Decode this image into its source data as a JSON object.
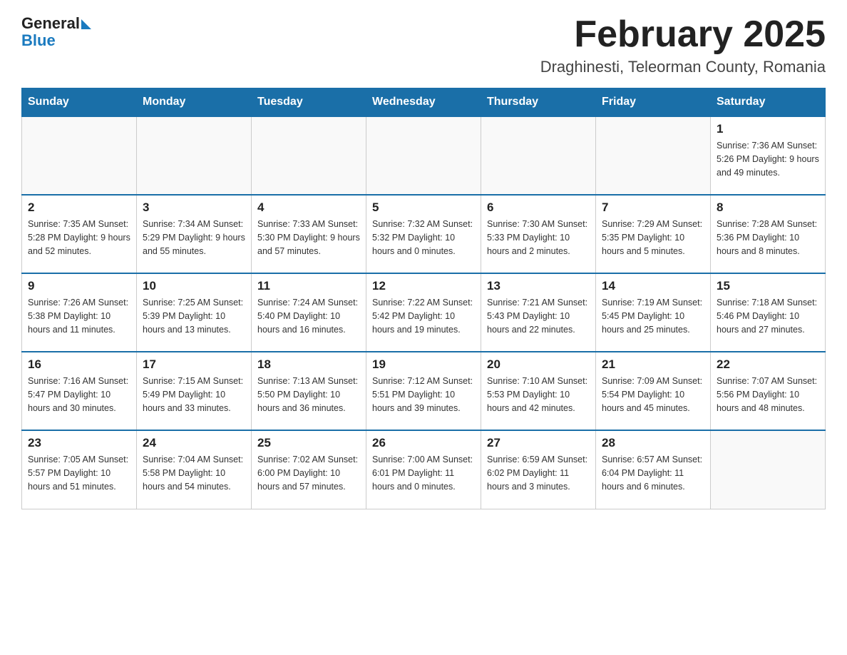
{
  "header": {
    "logo_text_general": "General",
    "logo_text_blue": "Blue",
    "title": "February 2025",
    "subtitle": "Draghinesti, Teleorman County, Romania"
  },
  "days_of_week": [
    "Sunday",
    "Monday",
    "Tuesday",
    "Wednesday",
    "Thursday",
    "Friday",
    "Saturday"
  ],
  "weeks": [
    [
      {
        "day": "",
        "info": ""
      },
      {
        "day": "",
        "info": ""
      },
      {
        "day": "",
        "info": ""
      },
      {
        "day": "",
        "info": ""
      },
      {
        "day": "",
        "info": ""
      },
      {
        "day": "",
        "info": ""
      },
      {
        "day": "1",
        "info": "Sunrise: 7:36 AM\nSunset: 5:26 PM\nDaylight: 9 hours and 49 minutes."
      }
    ],
    [
      {
        "day": "2",
        "info": "Sunrise: 7:35 AM\nSunset: 5:28 PM\nDaylight: 9 hours and 52 minutes."
      },
      {
        "day": "3",
        "info": "Sunrise: 7:34 AM\nSunset: 5:29 PM\nDaylight: 9 hours and 55 minutes."
      },
      {
        "day": "4",
        "info": "Sunrise: 7:33 AM\nSunset: 5:30 PM\nDaylight: 9 hours and 57 minutes."
      },
      {
        "day": "5",
        "info": "Sunrise: 7:32 AM\nSunset: 5:32 PM\nDaylight: 10 hours and 0 minutes."
      },
      {
        "day": "6",
        "info": "Sunrise: 7:30 AM\nSunset: 5:33 PM\nDaylight: 10 hours and 2 minutes."
      },
      {
        "day": "7",
        "info": "Sunrise: 7:29 AM\nSunset: 5:35 PM\nDaylight: 10 hours and 5 minutes."
      },
      {
        "day": "8",
        "info": "Sunrise: 7:28 AM\nSunset: 5:36 PM\nDaylight: 10 hours and 8 minutes."
      }
    ],
    [
      {
        "day": "9",
        "info": "Sunrise: 7:26 AM\nSunset: 5:38 PM\nDaylight: 10 hours and 11 minutes."
      },
      {
        "day": "10",
        "info": "Sunrise: 7:25 AM\nSunset: 5:39 PM\nDaylight: 10 hours and 13 minutes."
      },
      {
        "day": "11",
        "info": "Sunrise: 7:24 AM\nSunset: 5:40 PM\nDaylight: 10 hours and 16 minutes."
      },
      {
        "day": "12",
        "info": "Sunrise: 7:22 AM\nSunset: 5:42 PM\nDaylight: 10 hours and 19 minutes."
      },
      {
        "day": "13",
        "info": "Sunrise: 7:21 AM\nSunset: 5:43 PM\nDaylight: 10 hours and 22 minutes."
      },
      {
        "day": "14",
        "info": "Sunrise: 7:19 AM\nSunset: 5:45 PM\nDaylight: 10 hours and 25 minutes."
      },
      {
        "day": "15",
        "info": "Sunrise: 7:18 AM\nSunset: 5:46 PM\nDaylight: 10 hours and 27 minutes."
      }
    ],
    [
      {
        "day": "16",
        "info": "Sunrise: 7:16 AM\nSunset: 5:47 PM\nDaylight: 10 hours and 30 minutes."
      },
      {
        "day": "17",
        "info": "Sunrise: 7:15 AM\nSunset: 5:49 PM\nDaylight: 10 hours and 33 minutes."
      },
      {
        "day": "18",
        "info": "Sunrise: 7:13 AM\nSunset: 5:50 PM\nDaylight: 10 hours and 36 minutes."
      },
      {
        "day": "19",
        "info": "Sunrise: 7:12 AM\nSunset: 5:51 PM\nDaylight: 10 hours and 39 minutes."
      },
      {
        "day": "20",
        "info": "Sunrise: 7:10 AM\nSunset: 5:53 PM\nDaylight: 10 hours and 42 minutes."
      },
      {
        "day": "21",
        "info": "Sunrise: 7:09 AM\nSunset: 5:54 PM\nDaylight: 10 hours and 45 minutes."
      },
      {
        "day": "22",
        "info": "Sunrise: 7:07 AM\nSunset: 5:56 PM\nDaylight: 10 hours and 48 minutes."
      }
    ],
    [
      {
        "day": "23",
        "info": "Sunrise: 7:05 AM\nSunset: 5:57 PM\nDaylight: 10 hours and 51 minutes."
      },
      {
        "day": "24",
        "info": "Sunrise: 7:04 AM\nSunset: 5:58 PM\nDaylight: 10 hours and 54 minutes."
      },
      {
        "day": "25",
        "info": "Sunrise: 7:02 AM\nSunset: 6:00 PM\nDaylight: 10 hours and 57 minutes."
      },
      {
        "day": "26",
        "info": "Sunrise: 7:00 AM\nSunset: 6:01 PM\nDaylight: 11 hours and 0 minutes."
      },
      {
        "day": "27",
        "info": "Sunrise: 6:59 AM\nSunset: 6:02 PM\nDaylight: 11 hours and 3 minutes."
      },
      {
        "day": "28",
        "info": "Sunrise: 6:57 AM\nSunset: 6:04 PM\nDaylight: 11 hours and 6 minutes."
      },
      {
        "day": "",
        "info": ""
      }
    ]
  ]
}
